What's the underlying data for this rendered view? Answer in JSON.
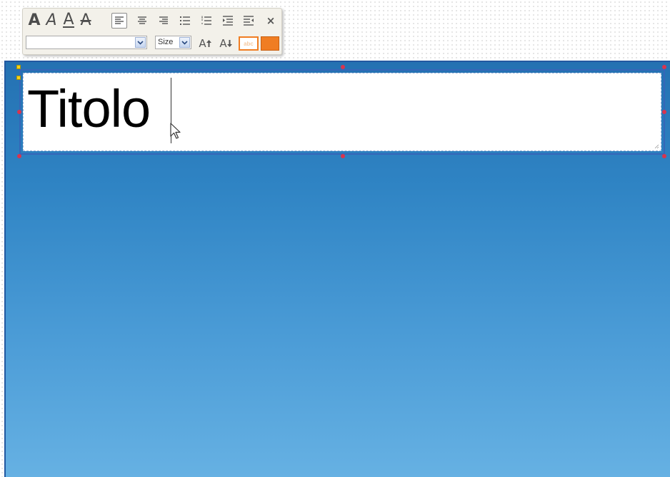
{
  "toolbar": {
    "format_buttons": [
      {
        "name": "bold-button",
        "glyph": "A"
      },
      {
        "name": "italic-button",
        "glyph": "A"
      },
      {
        "name": "underline-button",
        "glyph": "A"
      },
      {
        "name": "strikethrough-button",
        "glyph": "A"
      }
    ],
    "close_glyph": "×",
    "font_select_value": "",
    "size_select_value": "Size",
    "grow_glyph": "A",
    "shrink_glyph": "A",
    "highlight_text": "abc",
    "highlight_color": "#f07d22",
    "font_color": "#f07d22",
    "icons": [
      "align-left-icon",
      "align-center-icon",
      "align-right-icon",
      "bullet-list-icon",
      "numbered-list-icon",
      "increase-indent-icon",
      "decrease-indent-icon",
      "close-icon",
      "chevron-down-icon",
      "grow-font-icon",
      "shrink-font-icon",
      "highlight-icon",
      "font-color-icon"
    ]
  },
  "slide": {
    "title_text": "Titolo",
    "background_top": "#2471b2",
    "background_bottom": "#66b1e3",
    "selection_color": "#3566b8",
    "handle_color": "#d8344f"
  }
}
